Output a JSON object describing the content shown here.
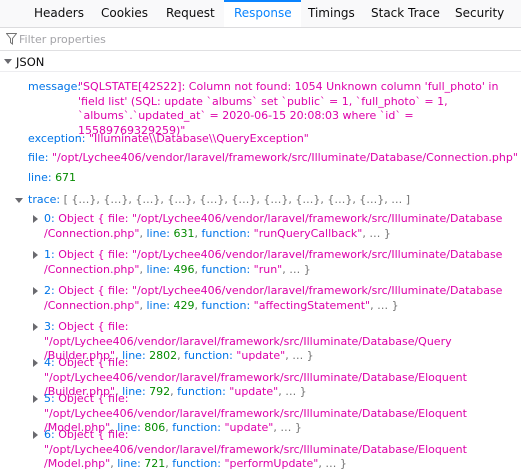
{
  "tabs": [
    {
      "label": "Headers",
      "active": false
    },
    {
      "label": "Cookies",
      "active": false
    },
    {
      "label": "Request",
      "active": false
    },
    {
      "label": "Response",
      "active": true
    },
    {
      "label": "Timings",
      "active": false
    },
    {
      "label": "Stack Trace",
      "active": false
    },
    {
      "label": "Security",
      "active": false
    }
  ],
  "filter": {
    "placeholder": "Filter properties",
    "icon": "filter-icon"
  },
  "json_section": {
    "label": "JSON",
    "expanded": true
  },
  "properties": {
    "message_key": "message: ",
    "message_value": "\"SQLSTATE[42S22]: Column not found: 1054 Unknown column 'full_photo' in 'field list' (SQL: update `albums` set `public` = 1, `full_photo` = 1, `albums`.`updated_at` = 2020-06-15 20:08:03 where `id` = 15589769329259)\"",
    "exception_key": "exception: ",
    "exception_value": "\"Illuminate\\\\Database\\\\QueryException\"",
    "file_key": "file: ",
    "file_value": "\"/opt/Lychee406/vendor/laravel/framework/src/Illuminate/Database/Connection.php\"",
    "line_key": "line: ",
    "line_value": "671",
    "trace_key": "trace: ",
    "trace_summary": "[ {…}, {…}, {…}, {…}, {…}, {…}, {…}, {…}, {…}, {…}, … ]"
  },
  "trace": [
    {
      "index": "0",
      "line1": "Object { file: \"/opt/Lychee406/vendor/laravel/framework/src/Illuminate/Database",
      "file_tail": "/Connection.php\"",
      "line": "631",
      "function": "\"runQueryCallback\""
    },
    {
      "index": "1",
      "line1": "Object { file: \"/opt/Lychee406/vendor/laravel/framework/src/Illuminate/Database",
      "file_tail": "/Connection.php\"",
      "line": "496",
      "function": "\"run\""
    },
    {
      "index": "2",
      "line1": "Object { file: \"/opt/Lychee406/vendor/laravel/framework/src/Illuminate/Database",
      "file_tail": "/Connection.php\"",
      "line": "429",
      "function": "\"affectingStatement\""
    },
    {
      "index": "3",
      "line1": "Object { file: \"/opt/Lychee406/vendor/laravel/framework/src/Illuminate/Database/Query",
      "file_tail": "/Builder.php\"",
      "line": "2802",
      "function": "\"update\""
    },
    {
      "index": "4",
      "line1": "Object { file: \"/opt/Lychee406/vendor/laravel/framework/src/Illuminate/Database/Eloquent",
      "file_tail": "/Builder.php\"",
      "line": "792",
      "function": "\"update\""
    },
    {
      "index": "5",
      "line1": "Object { file: \"/opt/Lychee406/vendor/laravel/framework/src/Illuminate/Database/Eloquent",
      "file_tail": "/Model.php\"",
      "line": "806",
      "function": "\"update\""
    },
    {
      "index": "6",
      "line1": "Object { file: \"/opt/Lychee406/vendor/laravel/framework/src/Illuminate/Database/Eloquent",
      "file_tail": "/Model.php\"",
      "line": "721",
      "function": "\"performUpdate\""
    }
  ],
  "labels": {
    "line_key": "line: ",
    "function_key": "function: ",
    "ellipsis": "… }",
    "sep": ", "
  },
  "colors": {
    "accent": "#0a84ff",
    "key": "#0074e8",
    "string": "#dd00a9",
    "number": "#058b00"
  }
}
